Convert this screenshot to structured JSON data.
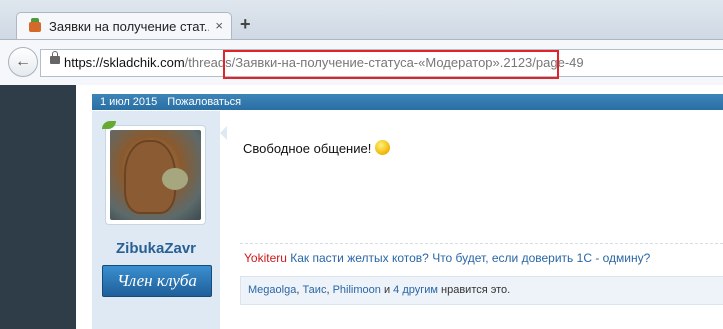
{
  "browser": {
    "tab_title": "Заявки на получение стат...",
    "tab_close": "×",
    "new_tab": "+",
    "url_host": "https://skladchik.com",
    "url_path": "/threads/Заявки-на-получение-статуса-«Модератор».2123/page-49",
    "back_icon": "back-arrow-icon"
  },
  "post": {
    "date": "1 июл 2015",
    "report": "Пожаловаться",
    "username": "ZibukaZavr",
    "rank": "Член клуба",
    "message": "Свободное общение!",
    "signature": {
      "author": "Yokiteru",
      "text": "Как пасти желтых котов? Что будет, если доверить 1С - одмину?"
    },
    "likes": {
      "user1": "Megaolga",
      "sep1": ", ",
      "user2": "Таис",
      "sep2": ", ",
      "user3": "Philimoon",
      "sep3": " и ",
      "others": "4 другим",
      "suffix": " нравится это."
    }
  },
  "colors": {
    "highlight": "#e0242a",
    "post_bar": "#2a6fa3",
    "username": "#2a5f94"
  }
}
